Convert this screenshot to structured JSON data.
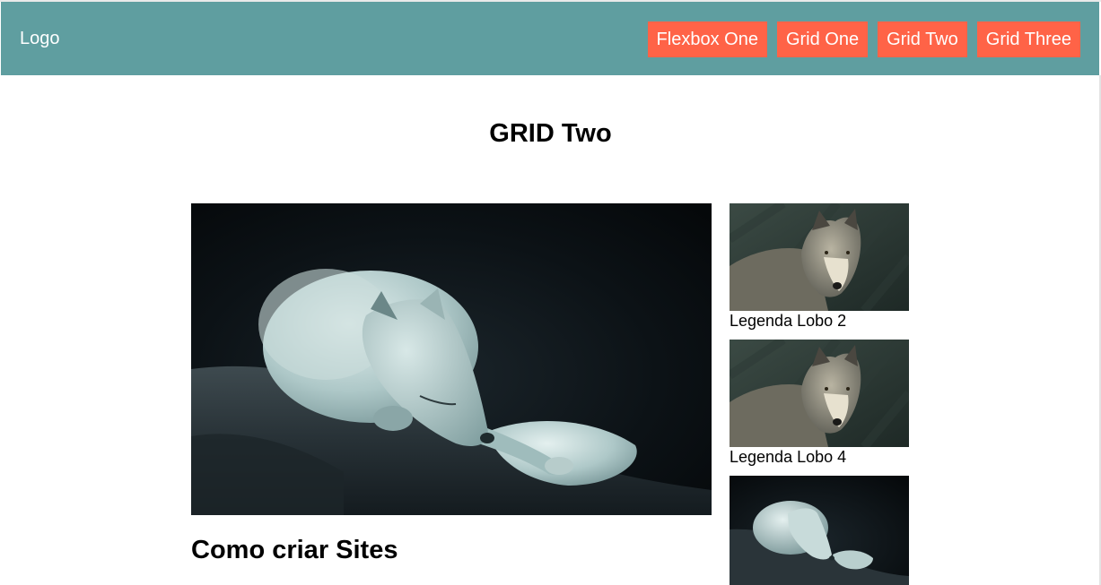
{
  "header": {
    "logo": "Logo",
    "nav": [
      {
        "label": "Flexbox One"
      },
      {
        "label": "Grid One"
      },
      {
        "label": "Grid Two"
      },
      {
        "label": "Grid Three"
      }
    ]
  },
  "page_title": "GRID Two",
  "main": {
    "heading": "Como criar Sites"
  },
  "sidebar": {
    "captions": [
      "Legenda Lobo 2",
      "Legenda Lobo 4"
    ]
  },
  "colors": {
    "header_bg": "#5f9ea0",
    "nav_button_bg": "#ff6347",
    "nav_text": "#ffffff"
  }
}
